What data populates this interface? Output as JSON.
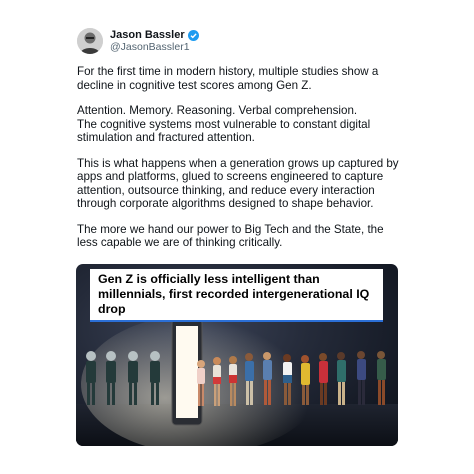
{
  "author": {
    "name": "Jason Bassler",
    "handle": "@JasonBassler1",
    "verified": true,
    "avatar_icon": "person-avatar-icon"
  },
  "tweet": {
    "paragraphs": [
      "For the first time in modern history, multiple studies show a\ndecline in cognitive test scores among Gen Z.",
      "Attention. Memory. Reasoning. Verbal comprehension.\nThe cognitive systems most vulnerable to constant digital\nstimulation and fractured attention.",
      "This is what happens when a generation grows up captured by\napps and platforms, glued to screens engineered to capture\nattention, outsource thinking, and reduce every interaction\nthrough corporate algorithms designed to shape behavior.",
      "The more we hand our power to Big Tech and the State, the\nless capable we are of thinking critically."
    ]
  },
  "media": {
    "headline": "Gen Z is officially less intelligent than millennials, first recorded intergenerational IQ drop",
    "accent_color": "#2b6fd6"
  },
  "colors": {
    "verified_badge": "#1d9bf0",
    "text": "#0f1419",
    "handle": "#536471"
  }
}
